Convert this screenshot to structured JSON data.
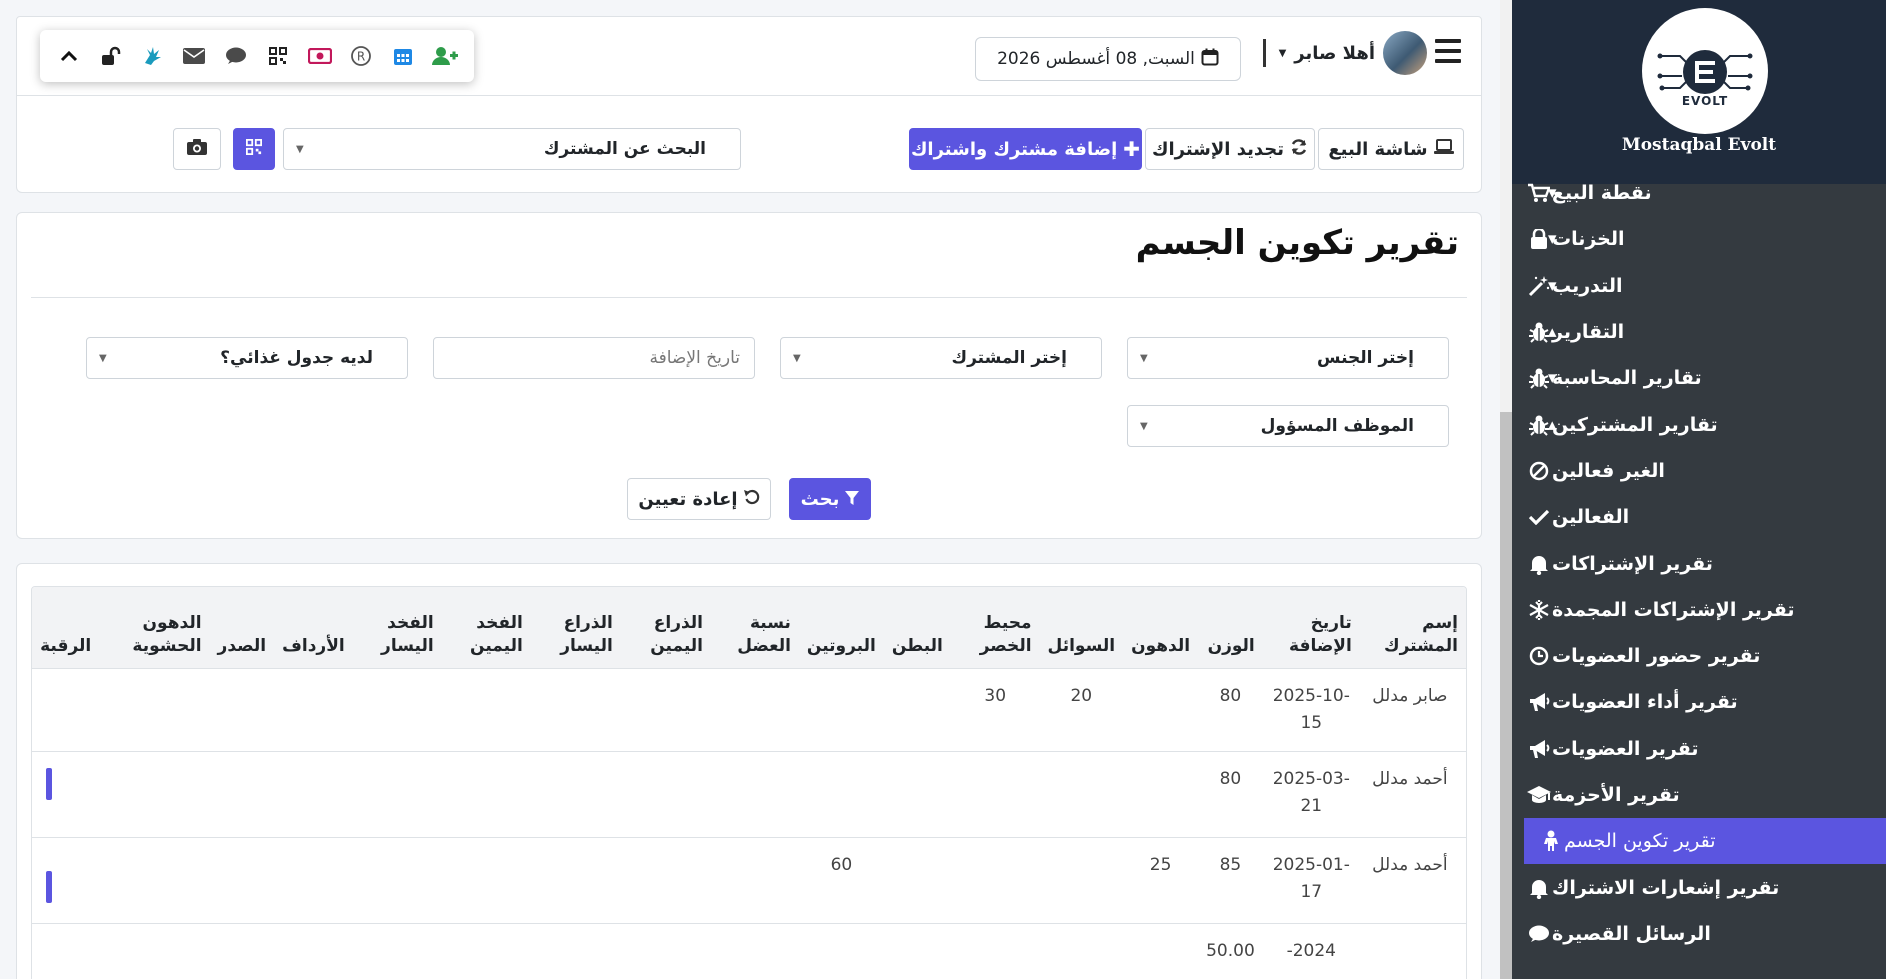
{
  "header": {
    "greeting": "أهلا صابر",
    "date": "السبت, 08 أغسطس 2026"
  },
  "toolbar_icons": [
    "chevron-up-icon",
    "unlock-icon",
    "sign-language-icon",
    "envelope-icon",
    "comment-icon",
    "qrcode-icon",
    "money-icon",
    "registered-icon",
    "calendar-icon",
    "user-plus-icon"
  ],
  "actions": {
    "pos_screen": "شاشة البيع",
    "renew_subscription": "تجديد الإشتراك",
    "add_member": "إضافة مشترك واشتراك",
    "search_member_placeholder": "البحث عن المشترك"
  },
  "page": {
    "title": "تقرير تكوين الجسم"
  },
  "filters": {
    "gender": "إختر الجنس",
    "member": "إختر المشترك",
    "date_added_placeholder": "تاريخ الإضافة",
    "has_diet": "لديه جدول غذائي؟",
    "staff": "الموظف المسؤول",
    "search_button": "بحث",
    "reset_button": "إعادة تعيين"
  },
  "table": {
    "headers": [
      "إسم المشترك",
      "تاريخ الإضافة",
      "الوزن",
      "الدهون",
      "السوائل",
      "محيط الخصر",
      "البطن",
      "البروتين",
      "نسبة العضل",
      "الذراع اليمين",
      "الذراع اليسار",
      "الفخد اليمين",
      "الفخد اليسار",
      "الأرداف",
      "الصدر",
      "الدهون الحشوية",
      "الرقبة"
    ],
    "rows": [
      [
        "صابر مدلل",
        "2025-10-15",
        "80",
        "",
        "20",
        "30",
        "",
        "",
        "",
        "",
        "",
        "",
        "",
        "",
        "",
        "",
        ""
      ],
      [
        "أحمد مدلل",
        "2025-03-21",
        "80",
        "",
        "",
        "",
        "",
        "",
        "",
        "",
        "",
        "",
        "",
        "",
        "",
        "",
        ""
      ],
      [
        "أحمد مدلل",
        "2025-01-17",
        "85",
        "25",
        "",
        "",
        "",
        "60",
        "",
        "",
        "",
        "",
        "",
        "",
        "",
        "",
        ""
      ],
      [
        "",
        "2024-",
        "50.00",
        "",
        "",
        "",
        "",
        "",
        "",
        "",
        "",
        "",
        "",
        "",
        "",
        "",
        ""
      ]
    ]
  },
  "brand": {
    "logo_text": "EVOLT",
    "name": "Mostaqbal Evolt"
  },
  "sidebar": {
    "items": [
      {
        "label": "نقطة البيع",
        "icon": "cart-icon",
        "caret": "▼"
      },
      {
        "label": "الخزنات",
        "icon": "lock-icon",
        "caret": "▼"
      },
      {
        "label": "التدريب",
        "icon": "magic-wand-icon",
        "caret": "▼"
      },
      {
        "label": "التقارير",
        "icon": "bug-icon",
        "caret": "▲"
      },
      {
        "label": "تقارير المحاسبة",
        "icon": "bug-icon",
        "caret": "▼"
      },
      {
        "label": "تقارير المشتركين",
        "icon": "bug-icon",
        "caret": "▲"
      },
      {
        "label": "الغير فعالين",
        "icon": "ban-icon"
      },
      {
        "label": "الفعالين",
        "icon": "check-icon"
      },
      {
        "label": "تقرير الإشتراكات",
        "icon": "bell-icon"
      },
      {
        "label": "تقرير الإشتراكات المجمدة",
        "icon": "snowflake-icon"
      },
      {
        "label": "تقرير حضور العضويات",
        "icon": "clock-icon"
      },
      {
        "label": "تقرير أداء العضويات",
        "icon": "bullhorn-icon"
      },
      {
        "label": "تقرير العضويات",
        "icon": "bullhorn-icon"
      },
      {
        "label": "تقرير الأحزمة",
        "icon": "graduation-cap-icon"
      },
      {
        "label": "تقرير تكوين الجسم",
        "icon": "child-icon"
      },
      {
        "label": "تقرير إشعارات الاشتراك",
        "icon": "bell-icon"
      },
      {
        "label": "الرسائل القصيرة",
        "icon": "comment-icon"
      }
    ]
  },
  "colors": {
    "primary": "#5b55e0",
    "sidebar_bg": "#343a40",
    "brand_bg": "#1f2b3c"
  }
}
